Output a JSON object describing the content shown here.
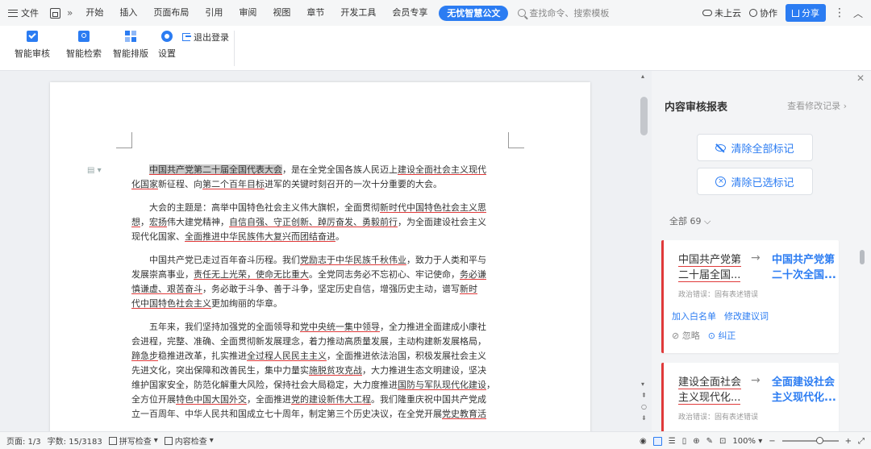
{
  "top": {
    "file_label": "文件",
    "tabs": [
      "开始",
      "插入",
      "页面布局",
      "引用",
      "审阅",
      "视图",
      "章节",
      "开发工具",
      "会员专享"
    ],
    "active_tab": "无忧智慧公文",
    "search_placeholder": "查找命令、搜索模板",
    "cloud_label": "未上云",
    "collab_label": "协作",
    "share_label": "分享"
  },
  "ribbon": {
    "review_label": "智能审核",
    "find_label": "智能检索",
    "layout_label": "智能排版",
    "settings_label": "设置",
    "logout_label": "退出登录"
  },
  "document": {
    "p1": [
      "中国共产党第二十届全国代表大会",
      "，是在全党全国各族人民迈上",
      "建设全面社会主义现代",
      "化国家",
      "新征程、向",
      "第二个百年目标",
      "进军的关键时刻召开的一次十分重要的大会。"
    ],
    "p2": [
      "大会的主题是：高举中国特色社会主义伟大旗帜，全面贯彻",
      "新时代中国特色社会主义思",
      "想",
      "，",
      "宏扬",
      "伟大建党精神，",
      "自信自强、守正创新、踔厉奋发、勇毅前行",
      "，为全面建设社会主义",
      "现代化国家、",
      "全面推进中华民族伟大复兴而团结奋进",
      "。"
    ],
    "p3": [
      "中国共产党已走过百年奋斗历程。我们",
      "党励志于中华民族千秋伟业",
      "，致力于人类和平与",
      "发展崇高事业，",
      "责任无上光荣，使命无比重大",
      "。全党同志务必不忘初心、牢记使命，",
      "务必谦",
      "慎谦虚、艰苦奋斗",
      "，务必敢于斗争、善于斗争，坚定历史自信，增强历史主动，谱写",
      "新时",
      "代中国特色社会主义",
      "更加绚丽的华章。"
    ],
    "p4": [
      "五年来，我们坚持加强党的全面领导和",
      "党中央统一集中领导",
      "，全力推进全面建成小康社",
      "会进程，完整、准确、全面贯彻新发展理念，着力推动高质量发展，主动构建新发展格局，",
      "蹄急步",
      "稳推进改革，扎实推进",
      "全过程人民民主主义",
      "，全面推进依法治国，积极发展社会主义",
      "先进文化，突出保障和改善民生，集中力量实",
      "施脱贫攻克战",
      "，大力推进生态文明建设，坚决",
      "维护国家安全，防范化解重大风险，保持社会大局稳定，大力度推进",
      "国防与军队现代化建设",
      "，",
      "全方位开展",
      "特色中国大国外交",
      "，全面推进",
      "党的建设新伟大工程",
      "。我们隆重庆祝中国共产党成",
      "立一百周年、中华人民共和国成立七十周年，制定第三个历史决议，在全党开展",
      "党史教育活"
    ]
  },
  "panel": {
    "title": "内容审核报表",
    "history_link": "查看修改记录",
    "clear_all": "清除全部标记",
    "clear_selected": "清除已选标记",
    "all_count": "全部 69",
    "cards": [
      {
        "original": "中国共产党第二十届全国...",
        "suggestion": "中国共产党第二十次全国...",
        "error_type": "政治错误：固有表述错误",
        "whitelist": "加入白名单",
        "modify": "修改建议词",
        "ignore": "忽略",
        "fix": "纠正"
      },
      {
        "original": "建设全面社会主义现代化...",
        "suggestion": "全面建设社会主义现代化...",
        "error_type": "政治错误：固有表述错误"
      }
    ]
  },
  "status": {
    "page": "页面: 1/3",
    "words": "字数: 15/3183",
    "spell": "拼写检查",
    "content_check": "内容检查",
    "zoom": "100%"
  }
}
